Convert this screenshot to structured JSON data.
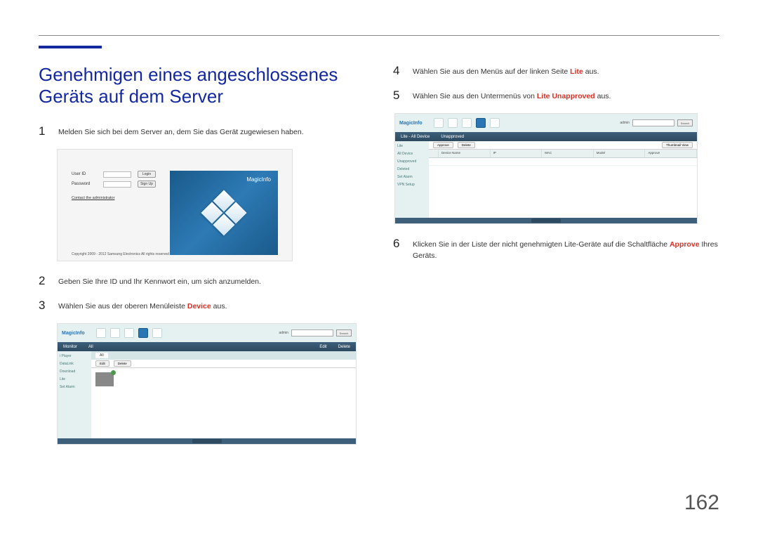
{
  "page_number": "162",
  "heading": "Genehmigen eines angeschlossenes Geräts auf dem Server",
  "steps": {
    "s1": {
      "num": "1",
      "text": "Melden Sie sich bei dem Server an, dem Sie das Gerät zugewiesen haben."
    },
    "s2": {
      "num": "2",
      "text": "Geben Sie Ihre ID und Ihr Kennwort ein, um sich anzumelden."
    },
    "s3": {
      "num": "3",
      "pre": "Wählen Sie aus der oberen Menüleiste ",
      "kw": "Device",
      "post": " aus."
    },
    "s4": {
      "num": "4",
      "pre": "Wählen Sie aus den Menüs auf der linken Seite ",
      "kw": "Lite",
      "post": " aus."
    },
    "s5": {
      "num": "5",
      "pre": "Wählen Sie aus den Untermenüs von ",
      "kw": "Lite Unapproved",
      "post": " aus."
    },
    "s6": {
      "num": "6",
      "pre": "Klicken Sie in der Liste der nicht genehmigten Lite-Geräte auf die Schaltfläche ",
      "kw": "Approve",
      "post": " Ihres Geräts."
    }
  },
  "login": {
    "user_label": "User ID",
    "pass_label": "Password",
    "login_btn": "Login",
    "signup_btn": "Sign Up",
    "contact": "Contact the administrator",
    "copyright": "Copyright 2009 - 2012 Samsung Electronics All rights reserved",
    "magicinfo": "MagicInfo"
  },
  "app": {
    "logo": "MagicInfo",
    "user_info": "admin",
    "search_btn": "Search",
    "menubar": [
      "Monitor",
      "All"
    ],
    "actions": [
      "Edit",
      "Delete"
    ],
    "sidebar_left": [
      "i Player",
      "DataLink",
      "Download",
      "Lite",
      "Set Alarm"
    ],
    "sidebar_right": [
      "Lite",
      "All Device",
      "Unapproved",
      "Deleted",
      "Set Alarm",
      "VPN Setup"
    ],
    "tabs": [
      "Lite - All Device",
      "Unapproved"
    ],
    "toolbar": [
      "Approve",
      "Delete",
      "Thumbnail View"
    ],
    "table_headers": [
      "",
      "Device Name",
      "IP",
      "MAC",
      "Model",
      "Approve"
    ]
  }
}
